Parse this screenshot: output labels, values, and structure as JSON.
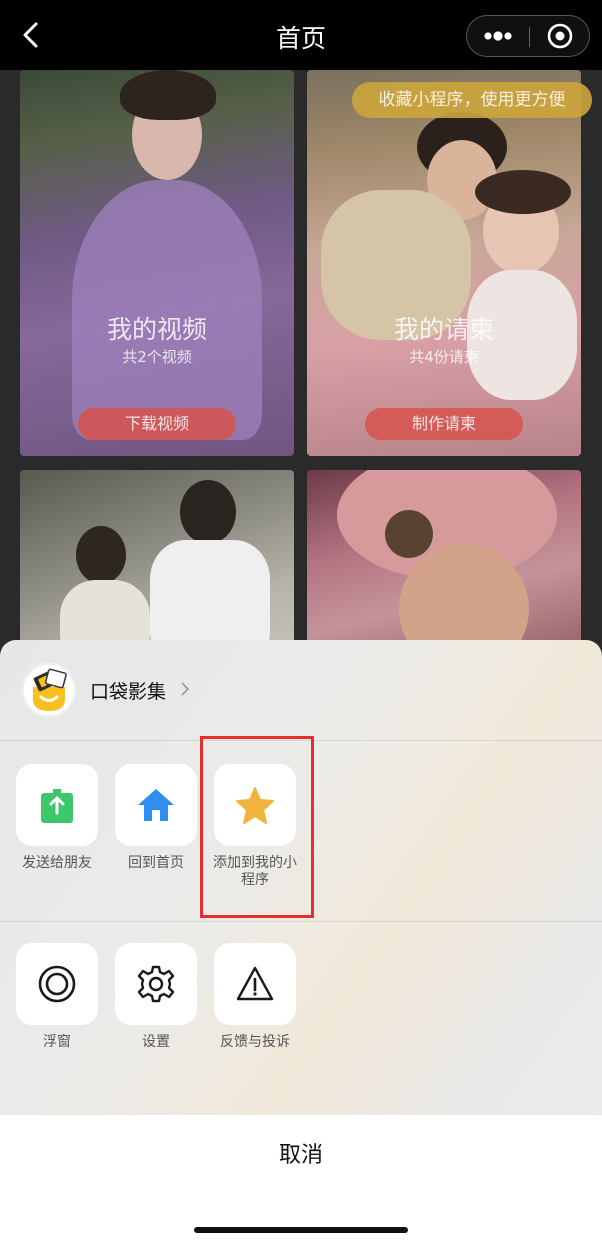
{
  "navbar": {
    "title": "首页"
  },
  "content": {
    "tip": "收藏小程序，使用更方便",
    "cards": [
      {
        "title": "我的视频",
        "subtitle": "共2个视频",
        "button": "下载视频"
      },
      {
        "title": "我的请柬",
        "subtitle": "共4份请柬",
        "button": "制作请柬"
      }
    ]
  },
  "sheet": {
    "app_name": "口袋影集",
    "row1": [
      {
        "label": "发送给朋友",
        "icon": "share-icon",
        "color": "#3cc76a"
      },
      {
        "label": "回到首页",
        "icon": "home-icon",
        "color": "#2f8ff0"
      },
      {
        "label": "添加到我的小程序",
        "icon": "star-icon",
        "color": "#f2b33c"
      }
    ],
    "row2": [
      {
        "label": "浮窗",
        "icon": "floating-window-icon"
      },
      {
        "label": "设置",
        "icon": "settings-gear-icon"
      },
      {
        "label": "反馈与投诉",
        "icon": "warning-icon"
      }
    ],
    "cancel": "取消"
  },
  "colors": {
    "highlight": "#e52e2e",
    "nav_background": "#000000"
  }
}
